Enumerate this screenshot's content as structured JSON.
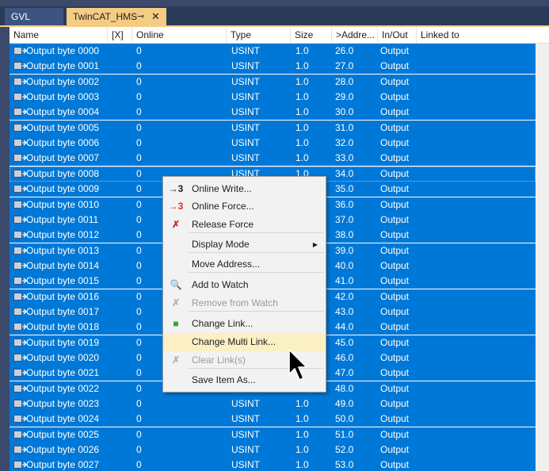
{
  "tabs": [
    {
      "label": "GVL"
    },
    {
      "label": "TwinCAT_HMS",
      "pin": "⊸",
      "close": "✕"
    }
  ],
  "columns": [
    "Name",
    "[X]",
    "Online",
    "Type",
    "Size",
    ">Addre...",
    "In/Out",
    "Linked to"
  ],
  "rows": [
    {
      "name": "Output byte 0000",
      "online": "0",
      "type": "USINT",
      "size": "1.0",
      "address": "26.0",
      "inout": "Output"
    },
    {
      "name": "Output byte 0001",
      "online": "0",
      "type": "USINT",
      "size": "1.0",
      "address": "27.0",
      "inout": "Output"
    },
    {
      "name": "Output byte 0002",
      "online": "0",
      "type": "USINT",
      "size": "1.0",
      "address": "28.0",
      "inout": "Output"
    },
    {
      "name": "Output byte 0003",
      "online": "0",
      "type": "USINT",
      "size": "1.0",
      "address": "29.0",
      "inout": "Output"
    },
    {
      "name": "Output byte 0004",
      "online": "0",
      "type": "USINT",
      "size": "1.0",
      "address": "30.0",
      "inout": "Output"
    },
    {
      "name": "Output byte 0005",
      "online": "0",
      "type": "USINT",
      "size": "1.0",
      "address": "31.0",
      "inout": "Output"
    },
    {
      "name": "Output byte 0006",
      "online": "0",
      "type": "USINT",
      "size": "1.0",
      "address": "32.0",
      "inout": "Output"
    },
    {
      "name": "Output byte 0007",
      "online": "0",
      "type": "USINT",
      "size": "1.0",
      "address": "33.0",
      "inout": "Output"
    },
    {
      "name": "Output byte 0008",
      "online": "0",
      "type": "USINT",
      "size": "1.0",
      "address": "34.0",
      "inout": "Output"
    },
    {
      "name": "Output byte 0009",
      "online": "0",
      "type": "",
      "size": "",
      "address": "35.0",
      "inout": "Output"
    },
    {
      "name": "Output byte 0010",
      "online": "0",
      "type": "",
      "size": "",
      "address": "36.0",
      "inout": "Output"
    },
    {
      "name": "Output byte 0011",
      "online": "0",
      "type": "",
      "size": "",
      "address": "37.0",
      "inout": "Output"
    },
    {
      "name": "Output byte 0012",
      "online": "0",
      "type": "",
      "size": "",
      "address": "38.0",
      "inout": "Output"
    },
    {
      "name": "Output byte 0013",
      "online": "0",
      "type": "",
      "size": "",
      "address": "39.0",
      "inout": "Output"
    },
    {
      "name": "Output byte 0014",
      "online": "0",
      "type": "",
      "size": "",
      "address": "40.0",
      "inout": "Output"
    },
    {
      "name": "Output byte 0015",
      "online": "0",
      "type": "",
      "size": "",
      "address": "41.0",
      "inout": "Output"
    },
    {
      "name": "Output byte 0016",
      "online": "0",
      "type": "",
      "size": "",
      "address": "42.0",
      "inout": "Output"
    },
    {
      "name": "Output byte 0017",
      "online": "0",
      "type": "",
      "size": "",
      "address": "43.0",
      "inout": "Output"
    },
    {
      "name": "Output byte 0018",
      "online": "0",
      "type": "",
      "size": "",
      "address": "44.0",
      "inout": "Output"
    },
    {
      "name": "Output byte 0019",
      "online": "0",
      "type": "",
      "size": "",
      "address": "45.0",
      "inout": "Output"
    },
    {
      "name": "Output byte 0020",
      "online": "0",
      "type": "",
      "size": "",
      "address": "46.0",
      "inout": "Output"
    },
    {
      "name": "Output byte 0021",
      "online": "0",
      "type": "",
      "size": "",
      "address": "47.0",
      "inout": "Output"
    },
    {
      "name": "Output byte 0022",
      "online": "0",
      "type": "",
      "size": "",
      "address": "48.0",
      "inout": "Output"
    },
    {
      "name": "Output byte 0023",
      "online": "0",
      "type": "USINT",
      "size": "1.0",
      "address": "49.0",
      "inout": "Output"
    },
    {
      "name": "Output byte 0024",
      "online": "0",
      "type": "USINT",
      "size": "1.0",
      "address": "50.0",
      "inout": "Output"
    },
    {
      "name": "Output byte 0025",
      "online": "0",
      "type": "USINT",
      "size": "1.0",
      "address": "51.0",
      "inout": "Output"
    },
    {
      "name": "Output byte 0026",
      "online": "0",
      "type": "USINT",
      "size": "1.0",
      "address": "52.0",
      "inout": "Output"
    },
    {
      "name": "Output byte 0027",
      "online": "0",
      "type": "USINT",
      "size": "1.0",
      "address": "53.0",
      "inout": "Output"
    }
  ],
  "context_menu": {
    "items": [
      {
        "label": "Online Write...",
        "icon": "arrow-3-icon",
        "glyph": "→3",
        "enabled": true
      },
      {
        "label": "Online Force...",
        "icon": "arrow-3-red-icon",
        "glyph": "→3",
        "enabled": true
      },
      {
        "label": "Release Force",
        "icon": "release-force-icon",
        "glyph": "✗",
        "enabled": true
      },
      {
        "label": "Display Mode",
        "icon": "",
        "enabled": true,
        "submenu": "▶"
      },
      {
        "label": "Move Address...",
        "icon": "",
        "enabled": true
      },
      {
        "label": "Add to Watch",
        "icon": "magnifier-icon",
        "glyph": "🔍",
        "enabled": true
      },
      {
        "label": "Remove from Watch",
        "icon": "remove-watch-icon",
        "glyph": "✗",
        "enabled": false
      },
      {
        "label": "Change Link...",
        "icon": "link-icon",
        "glyph": "■",
        "enabled": true
      },
      {
        "label": "Change Multi Link...",
        "icon": "",
        "enabled": true,
        "highlighted": true
      },
      {
        "label": "Clear Link(s)",
        "icon": "clear-link-icon",
        "glyph": "✗",
        "enabled": false
      },
      {
        "label": "Save Item As...",
        "icon": "",
        "enabled": true
      }
    ]
  },
  "colors": {
    "selection": "#0078d7",
    "accent_tab": "#f5cc84",
    "menu_hover": "#fbf0c4"
  }
}
